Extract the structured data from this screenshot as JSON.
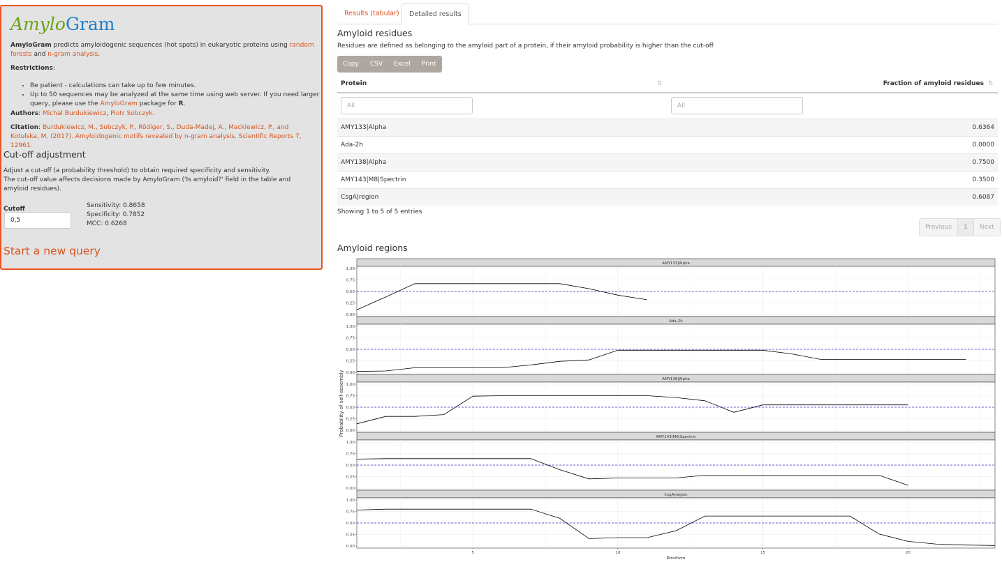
{
  "sidebar": {
    "logo_part1": "Amylo",
    "logo_part2": "Gram",
    "intro": {
      "bold": "AmyloGram",
      "text1": " predicts amyloidogenic sequences (hot spots) in eukaryotic proteins using ",
      "link1": "random forests",
      "text2": " and ",
      "link2": "n-gram analysis",
      "text3": "."
    },
    "restrictions_label": "Restrictions",
    "restrictions_colon": ":",
    "restrictions": {
      "item1": "Be patient - calculations can take up to few minutes.",
      "item2_text1": "Up to 50 sequences may be analyzed at the same time using web server. If you need larger query, please use the ",
      "item2_link": "AmyloGram",
      "item2_text2": " package for ",
      "item2_bold": "R",
      "item2_text3": "."
    },
    "authors_label": "Authors",
    "authors_colon": ": ",
    "author1": "Michal Burdukiewicz",
    "authors_sep": ", ",
    "author2": "Piotr Sobczyk",
    "authors_end": ".",
    "citation_label": "Citation",
    "citation_colon": ": ",
    "citation_text": "Burdukiewicz, M., Sobczyk, P., Rödiger, S., Duda-Madej, A., Mackiewicz, P., and Kotulska, M. (2017). Amyloidogenic motifs revealed by n-gram analysis. Scientific Reports 7, 12961.",
    "cutoff_title": "Cut-off adjustment",
    "cutoff_desc1": "Adjust a cut-off (a probability threshold) to obtain required specificity and sensitivity.",
    "cutoff_desc2": "The cut-off value affects decisions made by AmyloGram ('Is amyloid?' field in the table and amyloid residues).",
    "cutoff_label": "Cutoff",
    "cutoff_value": "0,5",
    "sensitivity": "Sensitivity: 0.8658",
    "specificity": "Specificity: 0.7852",
    "mcc": "MCC: 0.6268",
    "new_query": "Start a new query"
  },
  "tabs": {
    "tab1": "Results (tabular)",
    "tab2": "Detailed results"
  },
  "residues": {
    "title": "Amyloid residues",
    "desc": "Residues are defined as belonging to the amyloid part of a protein, if their amyloid probability is higher than the cut-off",
    "buttons": {
      "copy": "Copy",
      "csv": "CSV",
      "excel": "Excel",
      "print": "Print"
    },
    "col_protein": "Protein",
    "col_fraction": "Fraction of amyloid residues",
    "filter_placeholder": "All",
    "rows": [
      {
        "protein": "AMY133|Alpha",
        "fraction": "0.6364"
      },
      {
        "protein": "Ada-2h",
        "fraction": "0.0000"
      },
      {
        "protein": "AMY138|Alpha",
        "fraction": "0.7500"
      },
      {
        "protein": "AMY143|M8|Spectrin",
        "fraction": "0.3500"
      },
      {
        "protein": "CsgA|region",
        "fraction": "0.6087"
      }
    ],
    "showing": "Showing 1 to 5 of 5 entries",
    "pagination": {
      "previous": "Previous",
      "current": "1",
      "next": "Next"
    }
  },
  "regions": {
    "title": "Amyloid regions"
  },
  "chart_data": {
    "type": "line",
    "xlabel": "Position",
    "ylabel": "Probability of self-assembly",
    "xlim": [
      1,
      23
    ],
    "ylim": [
      0,
      1
    ],
    "x_ticks": [
      5,
      10,
      15,
      20
    ],
    "y_ticks": [
      "0.00",
      "0.25",
      "0.50",
      "0.75",
      "1.00"
    ],
    "cutoff_line": 0.5,
    "grid": true,
    "colors": {
      "line": "#000000",
      "cutoff": "#3333cc",
      "strip": "#d9d9d9"
    },
    "panels": [
      {
        "name": "AMY133|Alpha",
        "x": [
          1,
          2,
          3,
          4,
          5,
          6,
          7,
          8,
          9,
          10,
          11
        ],
        "y": [
          0.1,
          0.38,
          0.67,
          0.67,
          0.67,
          0.67,
          0.67,
          0.67,
          0.56,
          0.42,
          0.32
        ]
      },
      {
        "name": "Ada-2h",
        "x": [
          1,
          2,
          3,
          4,
          5,
          6,
          7,
          8,
          9,
          10,
          11,
          12,
          13,
          14,
          15,
          16,
          17,
          18,
          19,
          20,
          21,
          22
        ],
        "y": [
          0.02,
          0.03,
          0.1,
          0.1,
          0.1,
          0.1,
          0.16,
          0.24,
          0.27,
          0.48,
          0.48,
          0.48,
          0.48,
          0.48,
          0.48,
          0.4,
          0.28,
          0.28,
          0.28,
          0.28,
          0.28,
          0.28
        ]
      },
      {
        "name": "AMY138|Alpha",
        "x": [
          1,
          2,
          3,
          4,
          5,
          6,
          7,
          8,
          9,
          10,
          11,
          12,
          13,
          14,
          15,
          16,
          17,
          18,
          19,
          20
        ],
        "y": [
          0.14,
          0.3,
          0.3,
          0.34,
          0.74,
          0.75,
          0.75,
          0.75,
          0.75,
          0.75,
          0.75,
          0.71,
          0.64,
          0.39,
          0.55,
          0.55,
          0.55,
          0.55,
          0.55,
          0.55
        ]
      },
      {
        "name": "AMY143|M8|Spectrin",
        "x": [
          1,
          2,
          3,
          4,
          5,
          6,
          7,
          8,
          9,
          10,
          11,
          12,
          13,
          14,
          15,
          16,
          17,
          18,
          19,
          20
        ],
        "y": [
          0.63,
          0.64,
          0.64,
          0.64,
          0.64,
          0.64,
          0.64,
          0.4,
          0.2,
          0.22,
          0.22,
          0.22,
          0.28,
          0.28,
          0.28,
          0.28,
          0.28,
          0.28,
          0.28,
          0.06
        ]
      },
      {
        "name": "CsgA|region",
        "x": [
          1,
          2,
          3,
          4,
          5,
          6,
          7,
          8,
          9,
          10,
          11,
          12,
          13,
          14,
          15,
          16,
          17,
          18,
          19,
          20,
          21,
          22,
          23
        ],
        "y": [
          0.78,
          0.8,
          0.8,
          0.8,
          0.8,
          0.8,
          0.8,
          0.6,
          0.16,
          0.18,
          0.18,
          0.33,
          0.65,
          0.65,
          0.65,
          0.65,
          0.65,
          0.65,
          0.26,
          0.1,
          0.04,
          0.02,
          0.01
        ]
      }
    ]
  }
}
